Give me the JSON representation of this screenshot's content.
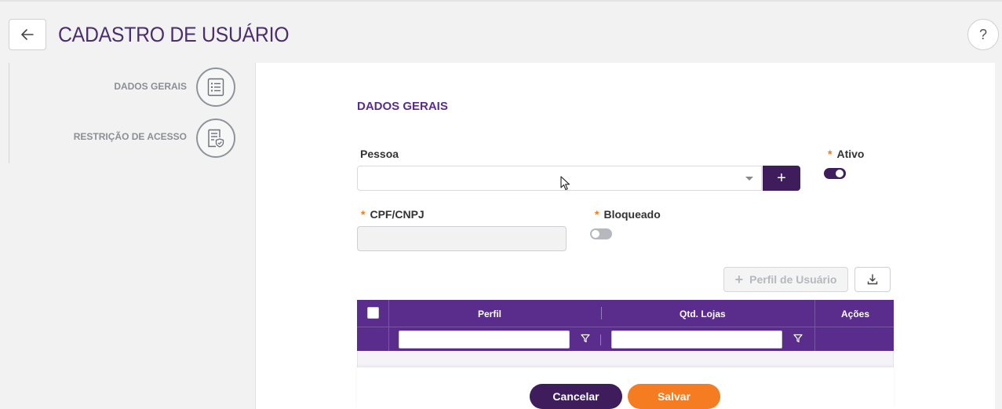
{
  "header": {
    "title": "CADASTRO DE USUÁRIO",
    "help_label": "?"
  },
  "stepper": {
    "items": [
      {
        "label": "DADOS GERAIS",
        "icon": "list-document-icon"
      },
      {
        "label": "RESTRIÇÃO DE ACESSO",
        "icon": "document-shield-icon"
      }
    ]
  },
  "form": {
    "section_title": "DADOS GERAIS",
    "pessoa": {
      "label": "Pessoa",
      "value": "",
      "add_label": "+"
    },
    "ativo": {
      "label": "Ativo",
      "required_mark": "*",
      "checked": true
    },
    "cpf": {
      "label": "CPF/CNPJ",
      "required_mark": "*",
      "value": ""
    },
    "bloqueado": {
      "label": "Bloqueado",
      "required_mark": "*",
      "checked": false
    }
  },
  "toolbar": {
    "perfil_button_label": "Perfil de Usuário",
    "perfil_button_icon": "+"
  },
  "grid": {
    "columns": [
      "Perfil",
      "Qtd. Lojas",
      "Ações"
    ],
    "filters": {
      "perfil": "",
      "qtd_lojas": ""
    }
  },
  "footer": {
    "cancel_label": "Cancelar",
    "save_label": "Salvar"
  },
  "colors": {
    "brand_purple": "#5a2d8c",
    "dark_purple": "#3f1d5c",
    "accent_orange": "#f57c20"
  }
}
